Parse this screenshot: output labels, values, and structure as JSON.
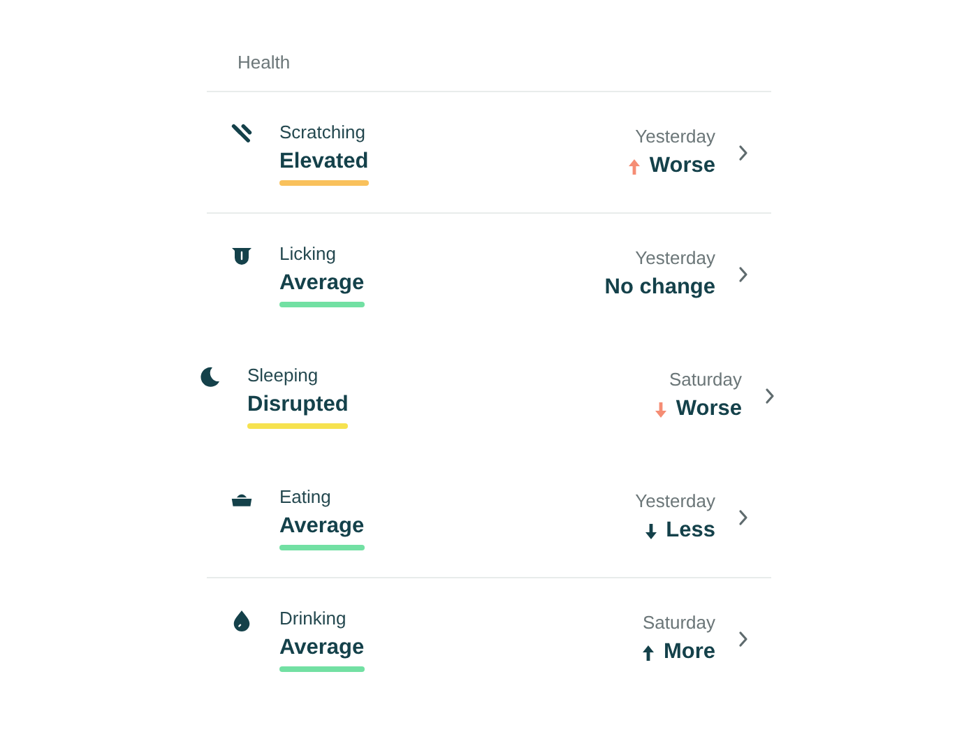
{
  "section": {
    "title": "Health"
  },
  "rows": [
    {
      "kind": "scratch",
      "label": "Scratching",
      "status": "Elevated",
      "color": "#f9c15c",
      "date": "Yesterday",
      "change": {
        "kind": "up",
        "color": "#f58d74",
        "text": "Worse"
      },
      "lifted": false,
      "divider": true
    },
    {
      "kind": "lick",
      "label": "Licking",
      "status": "Average",
      "color": "#72e0a3",
      "date": "Yesterday",
      "change": {
        "kind": "none",
        "text": "No change"
      },
      "lifted": false,
      "divider": false
    },
    {
      "kind": "sleep",
      "label": "Sleeping",
      "status": "Disrupted",
      "color": "#f6e24f",
      "date": "Saturday",
      "change": {
        "kind": "down",
        "color": "#f58d74",
        "text": "Worse"
      },
      "lifted": true,
      "divider": false
    },
    {
      "kind": "eat",
      "label": "Eating",
      "status": "Average",
      "color": "#72e0a3",
      "date": "Yesterday",
      "change": {
        "kind": "down",
        "color": "#14414a",
        "text": "Less"
      },
      "lifted": false,
      "divider": true
    },
    {
      "kind": "drink",
      "label": "Drinking",
      "status": "Average",
      "color": "#72e0a3",
      "date": "Saturday",
      "change": {
        "kind": "up",
        "color": "#14414a",
        "text": "More"
      },
      "lifted": false,
      "divider": false
    }
  ]
}
